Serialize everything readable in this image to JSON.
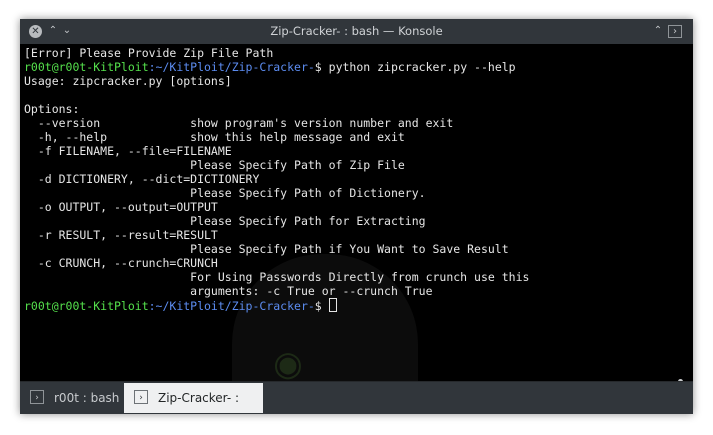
{
  "window": {
    "title": "Zip-Cracker- : bash — Konsole",
    "close_glyph": "✕",
    "minimize_glyph": "⌃",
    "maximize_glyph": "⌄",
    "keep_above_glyph": "⌃",
    "menu_glyph": "›"
  },
  "terminal": {
    "lines": [
      {
        "text": "[Error] Please Provide Zip File Path"
      },
      {
        "user": "r00t@r00t-KitPloit",
        "path": ":~/KitPloit/Zip-Cracker-",
        "prompt": "$ ",
        "cmd": "python zipcracker.py --help"
      },
      {
        "text": "Usage: zipcracker.py [options]"
      },
      {
        "text": ""
      },
      {
        "text": "Options:"
      },
      {
        "text": "  --version             show program's version number and exit"
      },
      {
        "text": "  -h, --help            show this help message and exit"
      },
      {
        "text": "  -f FILENAME, --file=FILENAME"
      },
      {
        "text": "                        Please Specify Path of Zip File"
      },
      {
        "text": "  -d DICTIONERY, --dict=DICTIONERY"
      },
      {
        "text": "                        Please Specify Path of Dictionery."
      },
      {
        "text": "  -o OUTPUT, --output=OUTPUT"
      },
      {
        "text": "                        Please Specify Path for Extracting"
      },
      {
        "text": "  -r RESULT, --result=RESULT"
      },
      {
        "text": "                        Please Specify Path if You Want to Save Result"
      },
      {
        "text": "  -c CRUNCH, --crunch=CRUNCH"
      },
      {
        "text": "                        For Using Passwords Directly from crunch use this"
      },
      {
        "text": "                        arguments: -c True or --crunch True"
      },
      {
        "user": "r00t@r00t-KitPloit",
        "path": ":~/KitPloit/Zip-Cracker-",
        "prompt": "$ ",
        "cmd": ""
      }
    ]
  },
  "tabs": [
    {
      "label": "r00t : bash",
      "icon": "terminal-icon",
      "active": false
    },
    {
      "label": "Zip-Cracker- : bash",
      "icon": "terminal-icon",
      "active": true
    }
  ],
  "colors": {
    "titlebar_bg": "#31363b",
    "terminal_bg": "#000000",
    "user_green": "#55e04c",
    "path_blue": "#5c8cf0",
    "text": "#e6e6e6"
  }
}
